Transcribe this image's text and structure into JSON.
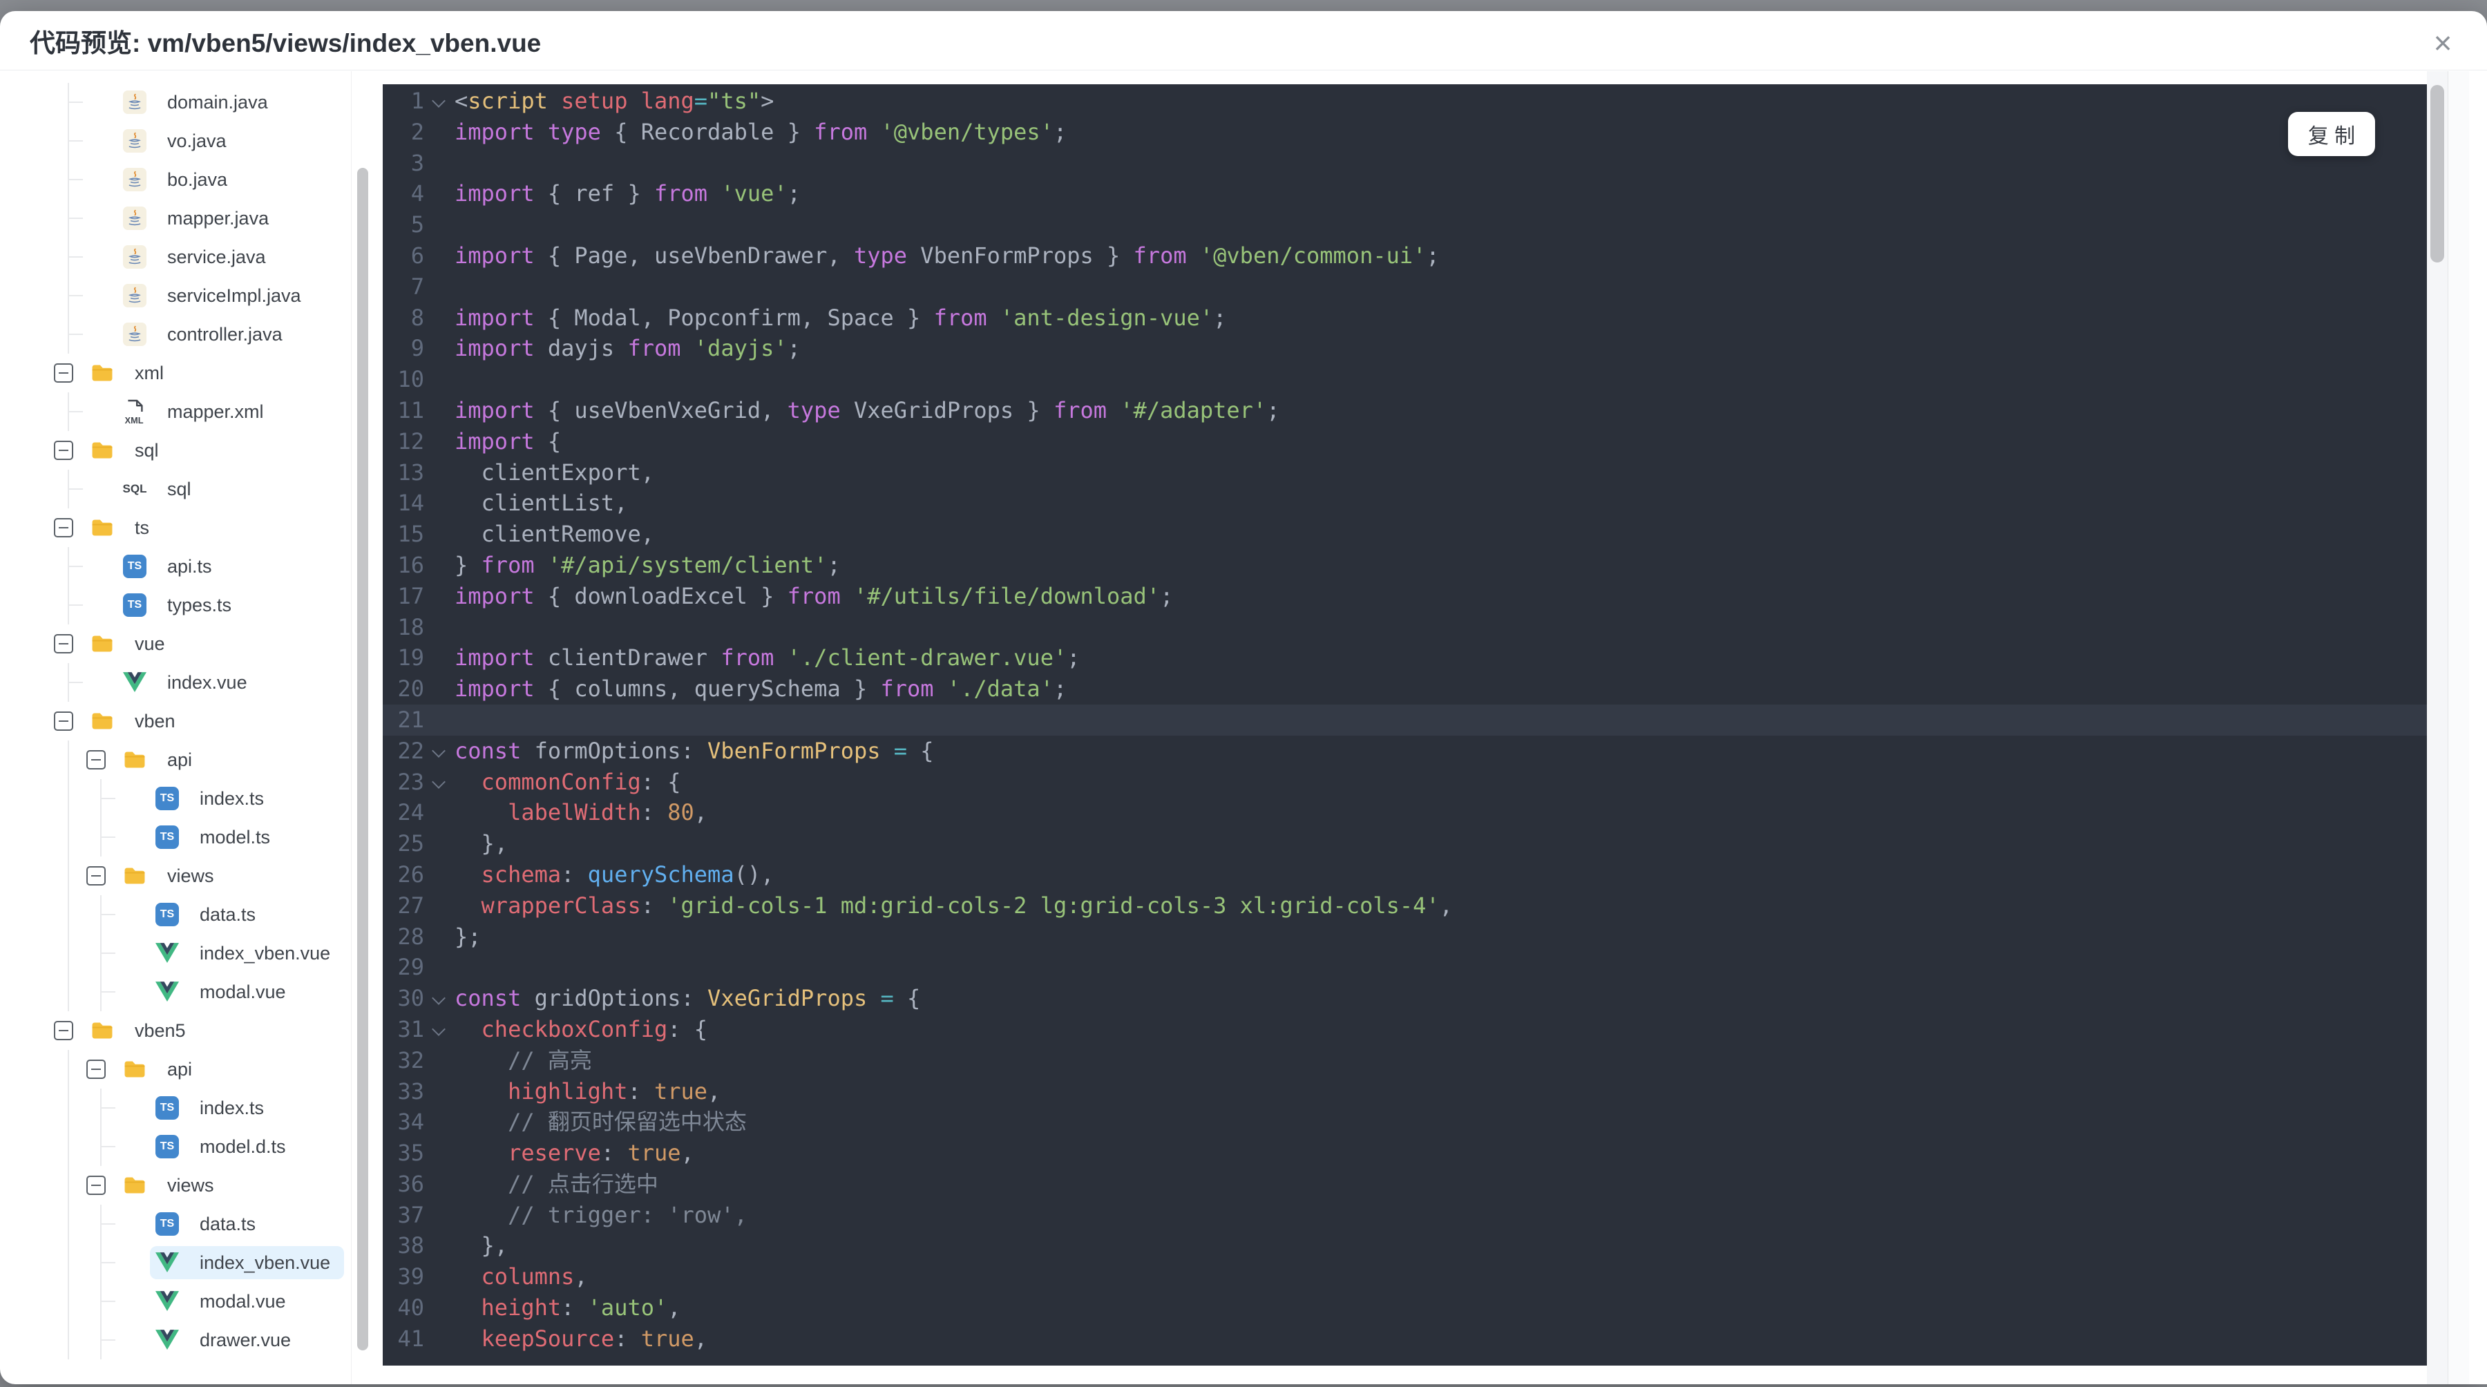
{
  "modal": {
    "title": "代码预览: vm/vben5/views/index_vben.vue",
    "close_icon": "×"
  },
  "tree": {
    "items": [
      {
        "label": "domain.java",
        "type": "java",
        "depth": 1
      },
      {
        "label": "vo.java",
        "type": "java",
        "depth": 1
      },
      {
        "label": "bo.java",
        "type": "java",
        "depth": 1
      },
      {
        "label": "mapper.java",
        "type": "java",
        "depth": 1
      },
      {
        "label": "service.java",
        "type": "java",
        "depth": 1
      },
      {
        "label": "serviceImpl.java",
        "type": "java",
        "depth": 1
      },
      {
        "label": "controller.java",
        "type": "java",
        "depth": 1
      },
      {
        "label": "xml",
        "type": "folder",
        "depth": 0,
        "expanded": true
      },
      {
        "label": "mapper.xml",
        "type": "xml",
        "depth": 1
      },
      {
        "label": "sql",
        "type": "folder",
        "depth": 0,
        "expanded": true
      },
      {
        "label": "sql",
        "type": "sql",
        "depth": 1
      },
      {
        "label": "ts",
        "type": "folder",
        "depth": 0,
        "expanded": true
      },
      {
        "label": "api.ts",
        "type": "ts",
        "depth": 1
      },
      {
        "label": "types.ts",
        "type": "ts",
        "depth": 1
      },
      {
        "label": "vue",
        "type": "folder",
        "depth": 0,
        "expanded": true
      },
      {
        "label": "index.vue",
        "type": "vue",
        "depth": 1
      },
      {
        "label": "vben",
        "type": "folder",
        "depth": 0,
        "expanded": true
      },
      {
        "label": "api",
        "type": "folder",
        "depth": 1,
        "expanded": true
      },
      {
        "label": "index.ts",
        "type": "ts",
        "depth": 2
      },
      {
        "label": "model.ts",
        "type": "ts",
        "depth": 2
      },
      {
        "label": "views",
        "type": "folder",
        "depth": 1,
        "expanded": true
      },
      {
        "label": "data.ts",
        "type": "ts",
        "depth": 2
      },
      {
        "label": "index_vben.vue",
        "type": "vue",
        "depth": 2
      },
      {
        "label": "modal.vue",
        "type": "vue",
        "depth": 2
      },
      {
        "label": "vben5",
        "type": "folder",
        "depth": 0,
        "expanded": true
      },
      {
        "label": "api",
        "type": "folder",
        "depth": 1,
        "expanded": true
      },
      {
        "label": "index.ts",
        "type": "ts",
        "depth": 2
      },
      {
        "label": "model.d.ts",
        "type": "ts",
        "depth": 2
      },
      {
        "label": "views",
        "type": "folder",
        "depth": 1,
        "expanded": true
      },
      {
        "label": "data.ts",
        "type": "ts",
        "depth": 2
      },
      {
        "label": "index_vben.vue",
        "type": "vue",
        "depth": 2,
        "selected": true
      },
      {
        "label": "modal.vue",
        "type": "vue",
        "depth": 2
      },
      {
        "label": "drawer.vue",
        "type": "vue",
        "depth": 2
      }
    ]
  },
  "code": {
    "copy_button": "复 制",
    "active_line": 21,
    "fold_lines": [
      1,
      22,
      23,
      30,
      31
    ],
    "lines": [
      {
        "n": 1,
        "t": [
          [
            "p",
            "<"
          ],
          [
            "ty",
            "script"
          ],
          [
            "p",
            " "
          ],
          [
            "prop",
            "setup"
          ],
          [
            "p",
            " "
          ],
          [
            "prop",
            "lang"
          ],
          [
            "op",
            "="
          ],
          [
            "s",
            "\"ts\""
          ],
          [
            "p",
            ">"
          ]
        ]
      },
      {
        "n": 2,
        "t": [
          [
            "k",
            "import"
          ],
          [
            "p",
            " "
          ],
          [
            "k",
            "type"
          ],
          [
            "p",
            " { Recordable } "
          ],
          [
            "k",
            "from"
          ],
          [
            "p",
            " "
          ],
          [
            "s",
            "'@vben/types'"
          ],
          [
            "p",
            ";"
          ]
        ]
      },
      {
        "n": 3,
        "t": []
      },
      {
        "n": 4,
        "t": [
          [
            "k",
            "import"
          ],
          [
            "p",
            " { ref } "
          ],
          [
            "k",
            "from"
          ],
          [
            "p",
            " "
          ],
          [
            "s",
            "'vue'"
          ],
          [
            "p",
            ";"
          ]
        ]
      },
      {
        "n": 5,
        "t": []
      },
      {
        "n": 6,
        "t": [
          [
            "k",
            "import"
          ],
          [
            "p",
            " { Page, useVbenDrawer, "
          ],
          [
            "k",
            "type"
          ],
          [
            "p",
            " VbenFormProps } "
          ],
          [
            "k",
            "from"
          ],
          [
            "p",
            " "
          ],
          [
            "s",
            "'@vben/common-ui'"
          ],
          [
            "p",
            ";"
          ]
        ]
      },
      {
        "n": 7,
        "t": []
      },
      {
        "n": 8,
        "t": [
          [
            "k",
            "import"
          ],
          [
            "p",
            " { Modal, Popconfirm, Space } "
          ],
          [
            "k",
            "from"
          ],
          [
            "p",
            " "
          ],
          [
            "s",
            "'ant-design-vue'"
          ],
          [
            "p",
            ";"
          ]
        ]
      },
      {
        "n": 9,
        "t": [
          [
            "k",
            "import"
          ],
          [
            "p",
            " dayjs "
          ],
          [
            "k",
            "from"
          ],
          [
            "p",
            " "
          ],
          [
            "s",
            "'dayjs'"
          ],
          [
            "p",
            ";"
          ]
        ]
      },
      {
        "n": 10,
        "t": []
      },
      {
        "n": 11,
        "t": [
          [
            "k",
            "import"
          ],
          [
            "p",
            " { useVbenVxeGrid, "
          ],
          [
            "k",
            "type"
          ],
          [
            "p",
            " VxeGridProps } "
          ],
          [
            "k",
            "from"
          ],
          [
            "p",
            " "
          ],
          [
            "s",
            "'#/adapter'"
          ],
          [
            "p",
            ";"
          ]
        ]
      },
      {
        "n": 12,
        "t": [
          [
            "k",
            "import"
          ],
          [
            "p",
            " {"
          ]
        ]
      },
      {
        "n": 13,
        "t": [
          [
            "p",
            "  clientExport,"
          ]
        ]
      },
      {
        "n": 14,
        "t": [
          [
            "p",
            "  clientList,"
          ]
        ]
      },
      {
        "n": 15,
        "t": [
          [
            "p",
            "  clientRemove,"
          ]
        ]
      },
      {
        "n": 16,
        "t": [
          [
            "p",
            "} "
          ],
          [
            "k",
            "from"
          ],
          [
            "p",
            " "
          ],
          [
            "s",
            "'#/api/system/client'"
          ],
          [
            "p",
            ";"
          ]
        ]
      },
      {
        "n": 17,
        "t": [
          [
            "k",
            "import"
          ],
          [
            "p",
            " { downloadExcel } "
          ],
          [
            "k",
            "from"
          ],
          [
            "p",
            " "
          ],
          [
            "s",
            "'#/utils/file/download'"
          ],
          [
            "p",
            ";"
          ]
        ]
      },
      {
        "n": 18,
        "t": []
      },
      {
        "n": 19,
        "t": [
          [
            "k",
            "import"
          ],
          [
            "p",
            " clientDrawer "
          ],
          [
            "k",
            "from"
          ],
          [
            "p",
            " "
          ],
          [
            "s",
            "'./client-drawer.vue'"
          ],
          [
            "p",
            ";"
          ]
        ]
      },
      {
        "n": 20,
        "t": [
          [
            "k",
            "import"
          ],
          [
            "p",
            " { columns, querySchema } "
          ],
          [
            "k",
            "from"
          ],
          [
            "p",
            " "
          ],
          [
            "s",
            "'./data'"
          ],
          [
            "p",
            ";"
          ]
        ]
      },
      {
        "n": 21,
        "t": []
      },
      {
        "n": 22,
        "t": [
          [
            "k",
            "const"
          ],
          [
            "p",
            " formOptions: "
          ],
          [
            "ty",
            "VbenFormProps"
          ],
          [
            "p",
            " "
          ],
          [
            "op",
            "="
          ],
          [
            "p",
            " {"
          ]
        ]
      },
      {
        "n": 23,
        "t": [
          [
            "p",
            "  "
          ],
          [
            "prop",
            "commonConfig"
          ],
          [
            "p",
            ": {"
          ]
        ]
      },
      {
        "n": 24,
        "t": [
          [
            "p",
            "    "
          ],
          [
            "prop",
            "labelWidth"
          ],
          [
            "p",
            ": "
          ],
          [
            "num",
            "80"
          ],
          [
            "p",
            ","
          ]
        ]
      },
      {
        "n": 25,
        "t": [
          [
            "p",
            "  },"
          ]
        ]
      },
      {
        "n": 26,
        "t": [
          [
            "p",
            "  "
          ],
          [
            "prop",
            "schema"
          ],
          [
            "p",
            ": "
          ],
          [
            "fn",
            "querySchema"
          ],
          [
            "p",
            "(),"
          ]
        ]
      },
      {
        "n": 27,
        "t": [
          [
            "p",
            "  "
          ],
          [
            "prop",
            "wrapperClass"
          ],
          [
            "p",
            ": "
          ],
          [
            "s",
            "'grid-cols-1 md:grid-cols-2 lg:grid-cols-3 xl:grid-cols-4'"
          ],
          [
            "p",
            ","
          ]
        ]
      },
      {
        "n": 28,
        "t": [
          [
            "p",
            "};"
          ]
        ]
      },
      {
        "n": 29,
        "t": []
      },
      {
        "n": 30,
        "t": [
          [
            "k",
            "const"
          ],
          [
            "p",
            " gridOptions: "
          ],
          [
            "ty",
            "VxeGridProps"
          ],
          [
            "p",
            " "
          ],
          [
            "op",
            "="
          ],
          [
            "p",
            " {"
          ]
        ]
      },
      {
        "n": 31,
        "t": [
          [
            "p",
            "  "
          ],
          [
            "prop",
            "checkboxConfig"
          ],
          [
            "p",
            ": {"
          ]
        ]
      },
      {
        "n": 32,
        "t": [
          [
            "p",
            "    "
          ],
          [
            "c",
            "// 高亮"
          ]
        ]
      },
      {
        "n": 33,
        "t": [
          [
            "p",
            "    "
          ],
          [
            "prop",
            "highlight"
          ],
          [
            "p",
            ": "
          ],
          [
            "num",
            "true"
          ],
          [
            "p",
            ","
          ]
        ]
      },
      {
        "n": 34,
        "t": [
          [
            "p",
            "    "
          ],
          [
            "c",
            "// 翻页时保留选中状态"
          ]
        ]
      },
      {
        "n": 35,
        "t": [
          [
            "p",
            "    "
          ],
          [
            "prop",
            "reserve"
          ],
          [
            "p",
            ": "
          ],
          [
            "num",
            "true"
          ],
          [
            "p",
            ","
          ]
        ]
      },
      {
        "n": 36,
        "t": [
          [
            "p",
            "    "
          ],
          [
            "c",
            "// 点击行选中"
          ]
        ]
      },
      {
        "n": 37,
        "t": [
          [
            "p",
            "    "
          ],
          [
            "c",
            "// trigger: 'row',"
          ]
        ]
      },
      {
        "n": 38,
        "t": [
          [
            "p",
            "  },"
          ]
        ]
      },
      {
        "n": 39,
        "t": [
          [
            "p",
            "  "
          ],
          [
            "prop",
            "columns"
          ],
          [
            "p",
            ","
          ]
        ]
      },
      {
        "n": 40,
        "t": [
          [
            "p",
            "  "
          ],
          [
            "prop",
            "height"
          ],
          [
            "p",
            ": "
          ],
          [
            "s",
            "'auto'"
          ],
          [
            "p",
            ","
          ]
        ]
      },
      {
        "n": 41,
        "t": [
          [
            "p",
            "  "
          ],
          [
            "prop",
            "keepSource"
          ],
          [
            "p",
            ": "
          ],
          [
            "num",
            "true"
          ],
          [
            "p",
            ","
          ]
        ]
      }
    ]
  },
  "colors": {
    "editor_background": "#2b303a",
    "active_line": "#343a46",
    "keyword": "#c678dd",
    "string": "#98c379",
    "property": "#e06c75",
    "number": "#d19a66",
    "type": "#e5c07b",
    "function": "#61afef",
    "operator": "#56b6c2",
    "comment": "#7f8896",
    "selected_tree_item": "#e4f2fd",
    "folder": "#f5bf3b",
    "ts_icon": "#4287cd",
    "vue_green": "#41b883"
  }
}
